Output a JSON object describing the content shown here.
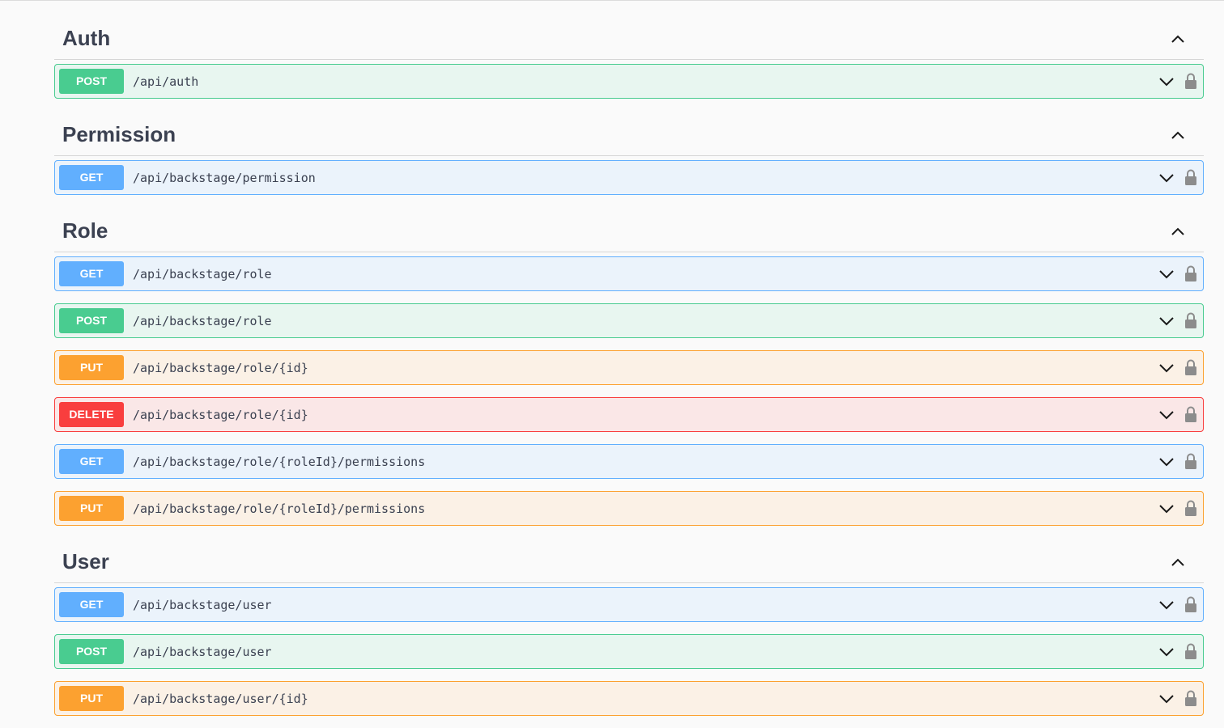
{
  "colors": {
    "get": "#61affe",
    "post": "#49cc90",
    "put": "#fca130",
    "delete": "#f93e3e",
    "text": "#3b4151"
  },
  "icons": {
    "section_toggle": "chevron-up-icon",
    "op_toggle": "chevron-down-icon",
    "auth": "lock-icon"
  },
  "sections": [
    {
      "title": "Auth",
      "operations": [
        {
          "method": "POST",
          "path": "/api/auth"
        }
      ]
    },
    {
      "title": "Permission",
      "operations": [
        {
          "method": "GET",
          "path": "/api/backstage/permission"
        }
      ]
    },
    {
      "title": "Role",
      "operations": [
        {
          "method": "GET",
          "path": "/api/backstage/role"
        },
        {
          "method": "POST",
          "path": "/api/backstage/role"
        },
        {
          "method": "PUT",
          "path": "/api/backstage/role/{id}"
        },
        {
          "method": "DELETE",
          "path": "/api/backstage/role/{id}"
        },
        {
          "method": "GET",
          "path": "/api/backstage/role/{roleId}/permissions"
        },
        {
          "method": "PUT",
          "path": "/api/backstage/role/{roleId}/permissions"
        }
      ]
    },
    {
      "title": "User",
      "operations": [
        {
          "method": "GET",
          "path": "/api/backstage/user"
        },
        {
          "method": "POST",
          "path": "/api/backstage/user"
        },
        {
          "method": "PUT",
          "path": "/api/backstage/user/{id}"
        }
      ]
    }
  ]
}
